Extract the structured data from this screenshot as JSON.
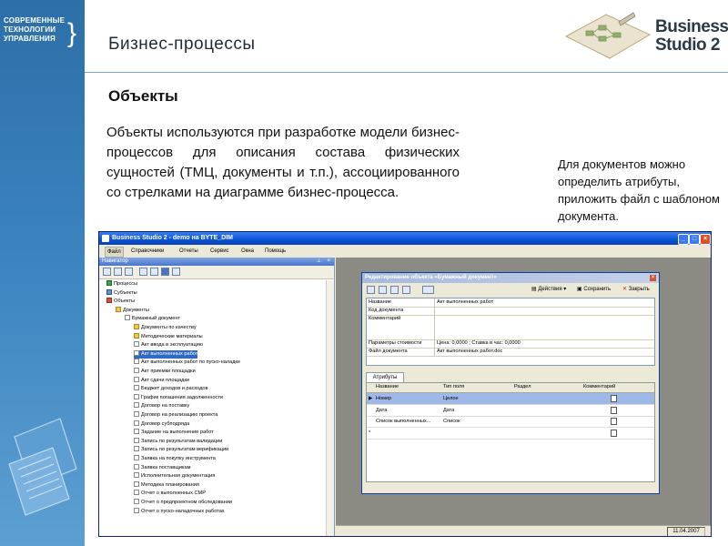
{
  "slide": {
    "title": "Бизнес-процессы",
    "section_title": "Объекты",
    "main_text": "Объекты используются при разработке модели бизнес-процессов для описания состава физических сущностей (ТМЦ, документы и т.п.), ассоциированного со стрелками на диаграмме бизнес-процесса.",
    "side_note": "Для документов можно определить атрибуты, приложить файл с шаблоном документа."
  },
  "company_logo": {
    "line1": "СОВРЕМЕННЫЕ",
    "line2": "ТЕХНОЛОГИИ",
    "line3": "УПРАВЛЕНИЯ"
  },
  "product_logo": {
    "line1": "Business",
    "line2": "Studio 2"
  },
  "app": {
    "window_title": "Business Studio 2 - demo на BYTE_DIM",
    "menu": [
      "Файл",
      "Справочники",
      "Отчеты",
      "Сервис",
      "Окна",
      "Помощь"
    ],
    "navigator_title": "Навигатор",
    "tree": [
      {
        "label": "Процессы",
        "icon": "green"
      },
      {
        "label": "Субъекты",
        "icon": "blue"
      },
      {
        "label": "Объекты",
        "icon": "red"
      },
      {
        "label": "Документы",
        "icon": "folder"
      },
      {
        "label": "Бумажный документ",
        "icon": "doc"
      },
      {
        "label": "Документы по качеству",
        "icon": "folder"
      },
      {
        "label": "Методические материалы",
        "icon": "folder"
      },
      {
        "label": "Акт ввода в эксплуатацию",
        "icon": "doc"
      },
      {
        "label": "Акт выполненных работ",
        "icon": "doc",
        "selected": true
      },
      {
        "label": "Акт выполненных работ по пуско-наладке",
        "icon": "doc"
      },
      {
        "label": "Акт приемки площадки",
        "icon": "doc"
      },
      {
        "label": "Акт сдачи площадки",
        "icon": "doc"
      },
      {
        "label": "Бюджет доходов и расходов",
        "icon": "doc"
      },
      {
        "label": "График погашения задолженности",
        "icon": "doc"
      },
      {
        "label": "Договор на поставку",
        "icon": "doc"
      },
      {
        "label": "Договор на реализацию проекта",
        "icon": "doc"
      },
      {
        "label": "Договор субподряда",
        "icon": "doc"
      },
      {
        "label": "Задание на выполнение работ",
        "icon": "doc"
      },
      {
        "label": "Запись по результатам валидации",
        "icon": "doc"
      },
      {
        "label": "Запись по результатам верификации",
        "icon": "doc"
      },
      {
        "label": "Заявка на покупку инструмента",
        "icon": "doc"
      },
      {
        "label": "Заявка поставщикам",
        "icon": "doc"
      },
      {
        "label": "Исполнительная документация",
        "icon": "doc"
      },
      {
        "label": "Методика планирования",
        "icon": "doc"
      },
      {
        "label": "Отчет о выполненных СМР",
        "icon": "doc"
      },
      {
        "label": "Отчет о предпроектном обследовании",
        "icon": "doc"
      },
      {
        "label": "Отчет о пуско-наладочных работах",
        "icon": "doc"
      }
    ],
    "dialog": {
      "title": "Редактирование объекта «Бумажный документ»",
      "actions_label": "Действия",
      "save_label": "Сохранить",
      "close_label": "Закрыть",
      "fields": [
        {
          "label": "Название",
          "value": "Акт выполненных работ"
        },
        {
          "label": "Код документа",
          "value": ""
        },
        {
          "label": "Комментарий",
          "value": ""
        },
        {
          "label": "Параметры стоимости",
          "value": "Цена: 0,0000 ; Ставка в час: 0,0000"
        },
        {
          "label": "Файл документа",
          "value": "Акт выполненных работ.doc"
        }
      ],
      "tab_label": "Атрибуты",
      "grid_headers": [
        "Название",
        "Тип поля",
        "Раздел",
        "Комментарий"
      ],
      "grid_rows": [
        {
          "marker": "▶",
          "name": "Номер",
          "type": "Целое",
          "section": "",
          "selected": true
        },
        {
          "marker": "",
          "name": "Дата",
          "type": "Дата",
          "section": ""
        },
        {
          "marker": "",
          "name": "Список выполненных...",
          "type": "Список",
          "section": ""
        },
        {
          "marker": "*",
          "name": "",
          "type": "",
          "section": ""
        }
      ]
    },
    "status_date": "11.04.2007"
  },
  "colors": {
    "left_strip": "#3a83bf",
    "title_bar": "#0a52d6",
    "selection": "#316ac5"
  }
}
